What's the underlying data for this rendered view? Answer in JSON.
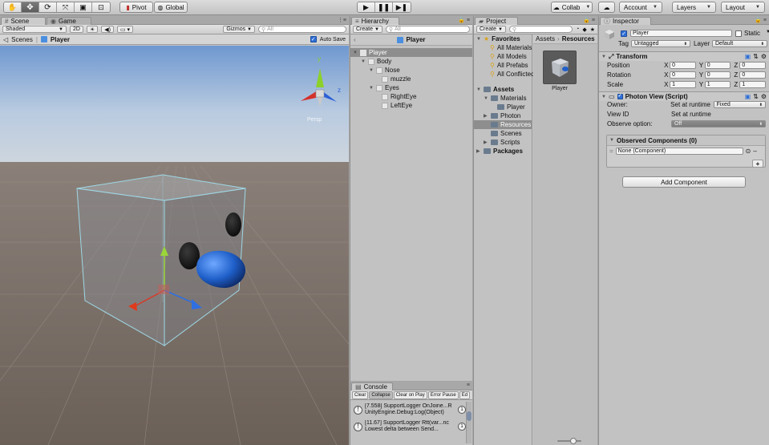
{
  "toolbar": {
    "pivot": "Pivot",
    "global": "Global",
    "collab": "Collab",
    "account": "Account",
    "layers": "Layers",
    "layout": "Layout"
  },
  "scene": {
    "tab_scene": "Scene",
    "tab_game": "Game",
    "shading": "Shaded",
    "mode_2d": "2D",
    "gizmos": "Gizmos",
    "search_placeholder": "All",
    "crumb_scenes": "Scenes",
    "crumb_player": "Player",
    "auto_save": "Auto Save",
    "persp": "Persp",
    "axis_y": "y",
    "axis_z": "z"
  },
  "hierarchy": {
    "tab": "Hierarchy",
    "create": "Create",
    "search_placeholder": "All",
    "title": "Player",
    "items": [
      {
        "label": "Player",
        "depth": 0,
        "selected": true
      },
      {
        "label": "Body",
        "depth": 1
      },
      {
        "label": "Nose",
        "depth": 2
      },
      {
        "label": "muzzle",
        "depth": 3
      },
      {
        "label": "Eyes",
        "depth": 2
      },
      {
        "label": "RightEye",
        "depth": 3
      },
      {
        "label": "LeftEye",
        "depth": 3
      }
    ]
  },
  "console": {
    "tab": "Console",
    "buttons": [
      "Clear",
      "Collapse",
      "Clear on Play",
      "Error Pause",
      "Ed"
    ],
    "logs": [
      {
        "line1": "[7.558] SupportLogger OnJoine...R",
        "line2": "UnityEngine.Debug:Log(Object)",
        "count": "1"
      },
      {
        "line1": "[11.67] SupportLogger Rtt(var...nc",
        "line2": "Lowest delta between Send...",
        "count": "1"
      }
    ]
  },
  "project": {
    "tab": "Project",
    "create": "Create",
    "favorites": "Favorites",
    "fav_items": [
      "All Materials",
      "All Models",
      "All Prefabs",
      "All Conflicted"
    ],
    "assets": "Assets",
    "tree": [
      {
        "label": "Materials",
        "depth": 1
      },
      {
        "label": "Player",
        "depth": 2
      },
      {
        "label": "Photon",
        "depth": 1
      },
      {
        "label": "Resources",
        "depth": 1,
        "selected": true
      },
      {
        "label": "Scenes",
        "depth": 1
      },
      {
        "label": "Scripts",
        "depth": 1
      }
    ],
    "packages": "Packages",
    "crumb_assets": "Assets",
    "crumb_resources": "Resources",
    "asset_name": "Player"
  },
  "inspector": {
    "tab": "Inspector",
    "object_name": "Player",
    "static": "Static",
    "tag_label": "Tag",
    "tag_value": "Untagged",
    "layer_label": "Layer",
    "layer_value": "Default",
    "transform": "Transform",
    "position": "Position",
    "rotation": "Rotation",
    "scale": "Scale",
    "axis_x": "X",
    "axis_y": "Y",
    "axis_z": "Z",
    "pos": [
      "0",
      "0",
      "0"
    ],
    "rot": [
      "0",
      "0",
      "0"
    ],
    "scl": [
      "1",
      "1",
      "1"
    ],
    "photon_view": "Photon View (Script)",
    "owner_label": "Owner:",
    "owner_value": "Set at runtime",
    "owner_option": "Fixed",
    "view_id_label": "View ID",
    "view_id_value": "Set at runtime",
    "observe_label": "Observe option:",
    "observe_value": "Off",
    "observed_components": "Observed Components (0)",
    "none_component": "None (Component)",
    "add_component": "Add Component"
  },
  "colors": {
    "sky_top": "#6f98d0",
    "ground": "#6e645c",
    "nose_blue": "#1f5fc9",
    "selection": "#8e8e8e"
  }
}
